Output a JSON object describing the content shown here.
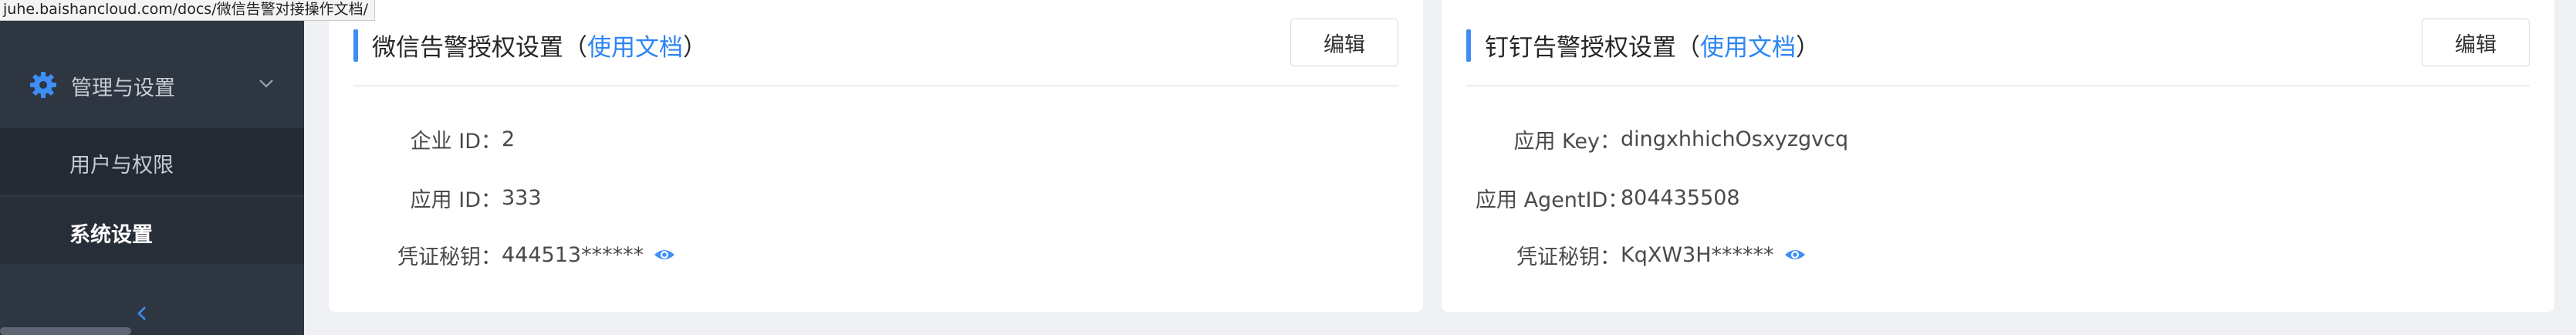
{
  "url_tooltip": "juhe.baishancloud.com/docs/微信告警对接操作文档/",
  "sidebar": {
    "group_label": "管理与设置",
    "items": [
      {
        "label": "用户与权限"
      },
      {
        "label": "系统设置"
      }
    ]
  },
  "wechat": {
    "title": "微信告警授权设置",
    "open_paren": "（",
    "doc_link": "使用文档",
    "close_paren": "）",
    "edit_label": "编辑",
    "fields": [
      {
        "label": "企业 ID：",
        "value": "2"
      },
      {
        "label": "应用 ID：",
        "value": "333"
      },
      {
        "label": "凭证秘钥：",
        "value": "444513******"
      }
    ]
  },
  "dingtalk": {
    "title": "钉钉告警授权设置",
    "open_paren": "（",
    "doc_link": "使用文档",
    "close_paren": "）",
    "edit_label": "编辑",
    "fields": [
      {
        "label": "应用 Key：",
        "value": "dingxhhichOsxyzgvcq"
      },
      {
        "label": "应用 AgentID：",
        "value": "804435508"
      },
      {
        "label": "凭证秘钥：",
        "value": "KqXW3H******"
      }
    ]
  },
  "colors": {
    "accent": "#3d8ff5",
    "link": "#2d85f2",
    "sidebar_bg": "#2e3642"
  }
}
